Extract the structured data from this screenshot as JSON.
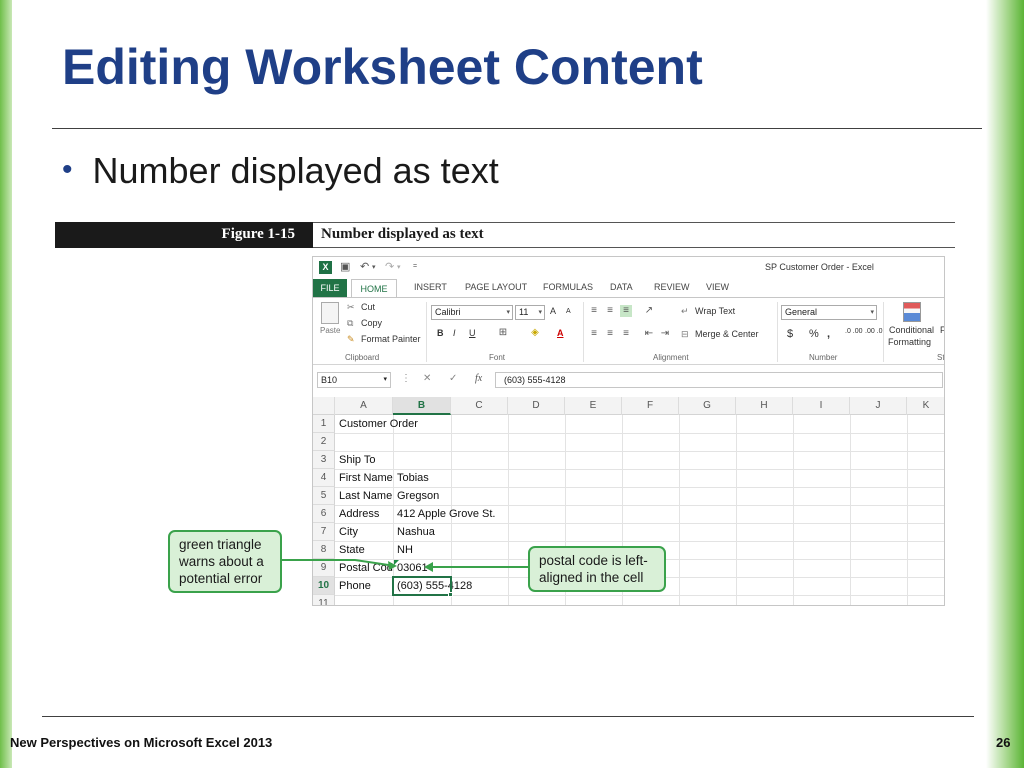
{
  "slide": {
    "title": "Editing Worksheet Content",
    "bullet": "Number displayed as text",
    "footer_left": "New Perspectives on Microsoft Excel 2013",
    "page_number": "26"
  },
  "figure": {
    "number": "Figure 1-15",
    "caption": "Number displayed as text"
  },
  "excel": {
    "window_title": "SP Customer Order - Excel",
    "logo_letter": "X",
    "tabs": {
      "file": "FILE",
      "home": "HOME",
      "others": [
        "INSERT",
        "PAGE LAYOUT",
        "FORMULAS",
        "DATA",
        "REVIEW",
        "VIEW"
      ]
    },
    "ribbon": {
      "clipboard": {
        "paste": "Paste",
        "cut": "Cut",
        "copy": "Copy",
        "format_painter": "Format Painter",
        "group": "Clipboard"
      },
      "font": {
        "name": "Calibri",
        "size": "11",
        "bold": "B",
        "italic": "I",
        "underline": "U",
        "grow": "A",
        "shrink": "A",
        "color_a": "A",
        "group": "Font"
      },
      "alignment": {
        "wrap_text": "Wrap Text",
        "merge_center": "Merge & Center",
        "group": "Alignment"
      },
      "number": {
        "format": "General",
        "currency": "$",
        "percent": "%",
        "comma": ",",
        "inc_dec": ".0 .00",
        "dec_dec": ".00 .0",
        "group": "Number"
      },
      "styles": {
        "cond_line1": "Conditional",
        "cond_line2": "Formatting",
        "f_letter": "F",
        "st": "St"
      }
    },
    "name_box": "B10",
    "formula_icon": "fx",
    "formula": "(603) 555-4128",
    "columns": [
      "A",
      "B",
      "C",
      "D",
      "E",
      "F",
      "G",
      "H",
      "I",
      "J",
      "K"
    ],
    "selected_column": "B",
    "rows": [
      "1",
      "2",
      "3",
      "4",
      "5",
      "6",
      "7",
      "8",
      "9",
      "10",
      "11"
    ],
    "selected_row": "10",
    "cells": {
      "r1a": "Customer Order",
      "r3a": "Ship To",
      "r4a": "First Name",
      "r4b": "Tobias",
      "r5a": "Last Name",
      "r5b": "Gregson",
      "r6a": "Address",
      "r6b": "412 Apple Grove St.",
      "r7a": "City",
      "r7b": "Nashua",
      "r8a": "State",
      "r8b": "NH",
      "r9a": "Postal Code",
      "r9b": "03061",
      "r10a": "Phone",
      "r10b": "(603) 555-4128"
    }
  },
  "callouts": {
    "left": [
      "green triangle",
      "warns about a",
      "potential error"
    ],
    "right": [
      "postal code is left-",
      "aligned in the cell"
    ]
  },
  "colors": {
    "title": "#1f3f87",
    "excel_green": "#217346",
    "callout_border": "#3aa24b",
    "callout_fill": "#d9f0d7"
  }
}
